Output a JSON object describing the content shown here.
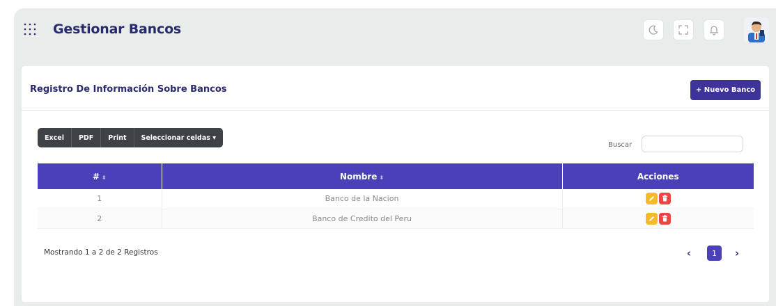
{
  "header": {
    "title": "Gestionar Bancos",
    "icons": [
      "grid-menu-icon",
      "moon-icon",
      "fullscreen-icon",
      "bell-icon",
      "avatar"
    ]
  },
  "card": {
    "title": "Registro De Información Sobre Bancos",
    "new_button": "+ Nuevo Banco"
  },
  "export_buttons": [
    "Excel",
    "PDF",
    "Print",
    "Seleccionar celdas ▾"
  ],
  "search": {
    "label": "Buscar",
    "value": ""
  },
  "table": {
    "columns": [
      "#",
      "Nombre",
      "Acciones"
    ],
    "sort_glyph": "⬍",
    "rows": [
      {
        "id": "1",
        "nombre": "Banco de la Nacion"
      },
      {
        "id": "2",
        "nombre": "Banco de Credito del Peru"
      }
    ]
  },
  "footer": {
    "info": "Mostrando 1 a 2 de 2 Registros"
  },
  "pagination": {
    "prev": "‹",
    "current": "1",
    "next": "›"
  },
  "colors": {
    "primary": "#4a41b8",
    "title": "#2a2b6e",
    "edit": "#f5b92a",
    "delete": "#ef4444"
  }
}
